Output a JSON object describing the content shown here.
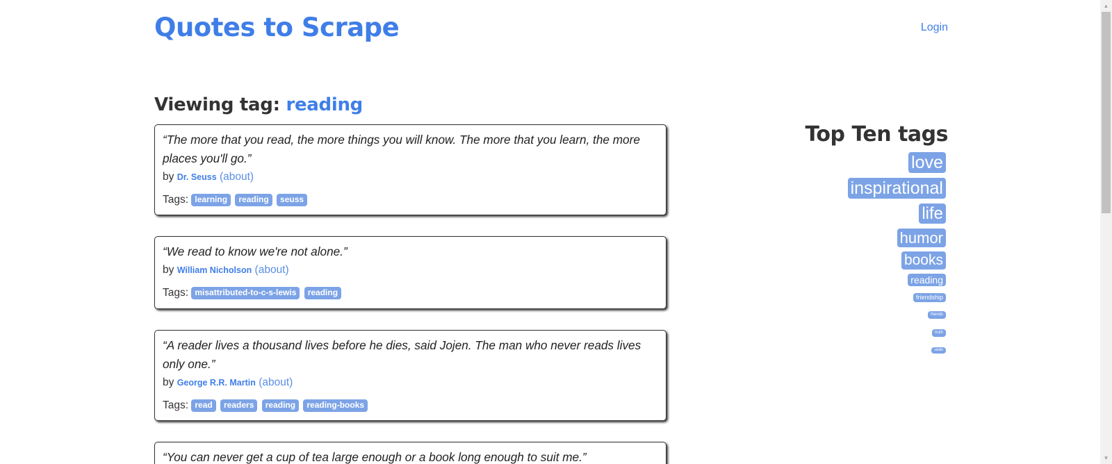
{
  "header": {
    "site_title": "Quotes to Scrape",
    "login": "Login"
  },
  "viewing": {
    "label": "Viewing tag: ",
    "tag": "reading"
  },
  "quotes": [
    {
      "text": "“The more that you read, the more things you will know. The more that you learn, the more places you'll go.”",
      "by": "by ",
      "author": "Dr. Seuss",
      "about": "(about)",
      "tags_label": "Tags: ",
      "tags": [
        "learning",
        "reading",
        "seuss"
      ]
    },
    {
      "text": "“We read to know we're not alone.”",
      "by": "by ",
      "author": "William Nicholson",
      "about": "(about)",
      "tags_label": "Tags: ",
      "tags": [
        "misattributed-to-c-s-lewis",
        "reading"
      ]
    },
    {
      "text": "“A reader lives a thousand lives before he dies, said Jojen. The man who never reads lives only one.”",
      "by": "by ",
      "author": "George R.R. Martin",
      "about": "(about)",
      "tags_label": "Tags: ",
      "tags": [
        "read",
        "readers",
        "reading",
        "reading-books"
      ]
    },
    {
      "text": "“You can never get a cup of tea large enough or a book long enough to suit me.”"
    }
  ],
  "sidebar": {
    "title": "Top Ten tags",
    "tags": [
      "love",
      "inspirational",
      "life",
      "humor",
      "books",
      "reading",
      "friendship",
      "friends",
      "truth",
      "simile"
    ]
  },
  "colors": {
    "accent": "#3f7ee8",
    "tag_bg": "#7ca3e6",
    "text": "#333333"
  }
}
